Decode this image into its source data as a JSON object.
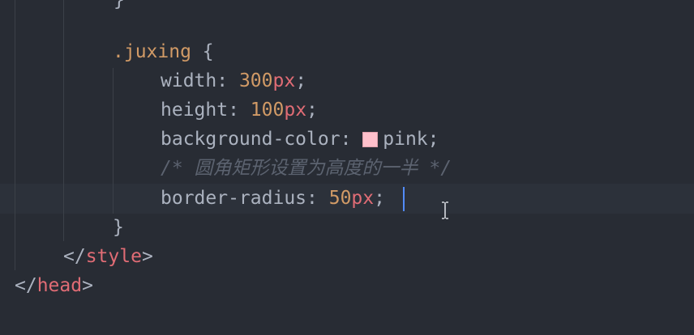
{
  "editor": {
    "theme_bg": "#282c34",
    "lines": {
      "top_fragment": "}",
      "selector": ".juxing",
      "open_brace": "{",
      "width_prop": "width",
      "width_num": "300",
      "width_unit": "px",
      "height_prop": "height",
      "height_num": "100",
      "height_unit": "px",
      "bg_prop": "background-color",
      "bg_value": "pink",
      "swatch_color": "#ffc0cb",
      "comment": "/* 圆角矩形设置为高度的一半 */",
      "radius_prop": "border-radius",
      "radius_num": "50",
      "radius_unit": "px",
      "close_brace": "}",
      "style_close_tag": "style",
      "head_close_tag": "head"
    }
  }
}
